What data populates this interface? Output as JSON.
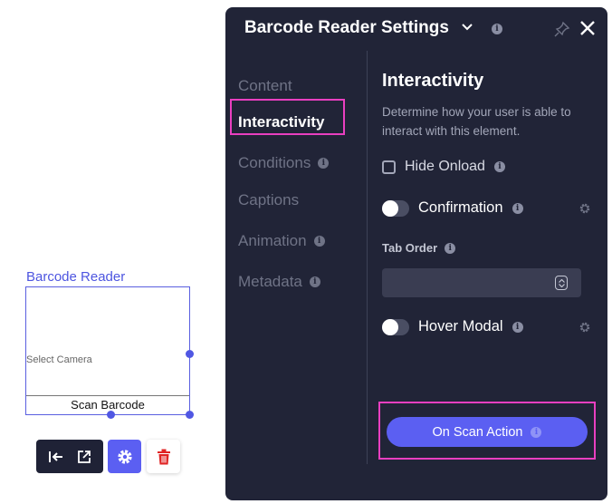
{
  "widget": {
    "title": "Barcode Reader",
    "select_camera": "Select Camera",
    "scan_button": "Scan Barcode"
  },
  "toolbar": {
    "icons": [
      "align-left-icon",
      "external-link-icon",
      "gear-icon",
      "trash-icon"
    ],
    "delete_color": "#e02424",
    "accent": "#5b5ff2"
  },
  "panel": {
    "title": "Barcode Reader Settings",
    "info": "i",
    "nav": [
      {
        "label": "Content",
        "info": ""
      },
      {
        "label": "Interactivity",
        "info": ""
      },
      {
        "label": "Conditions",
        "info": "i"
      },
      {
        "label": "Captions",
        "info": ""
      },
      {
        "label": "Animation",
        "info": "i"
      },
      {
        "label": "Metadata",
        "info": "i"
      }
    ],
    "active_nav": "Interactivity"
  },
  "interactivity": {
    "title": "Interactivity",
    "description": "Determine how your user is able to interact with this element.",
    "hide_onload": {
      "label": "Hide Onload",
      "checked": false,
      "info": "i"
    },
    "confirmation": {
      "label": "Confirmation",
      "enabled": false,
      "info": "i"
    },
    "tab_order": {
      "label": "Tab Order",
      "value": "",
      "info": "i"
    },
    "hover_modal": {
      "label": "Hover Modal",
      "enabled": false,
      "info": "i"
    },
    "scan_action": {
      "label": "On Scan Action",
      "info": "i"
    }
  },
  "colors": {
    "panel_bg": "#212437",
    "highlight": "#e93fc0",
    "primary": "#5b5ff2"
  }
}
